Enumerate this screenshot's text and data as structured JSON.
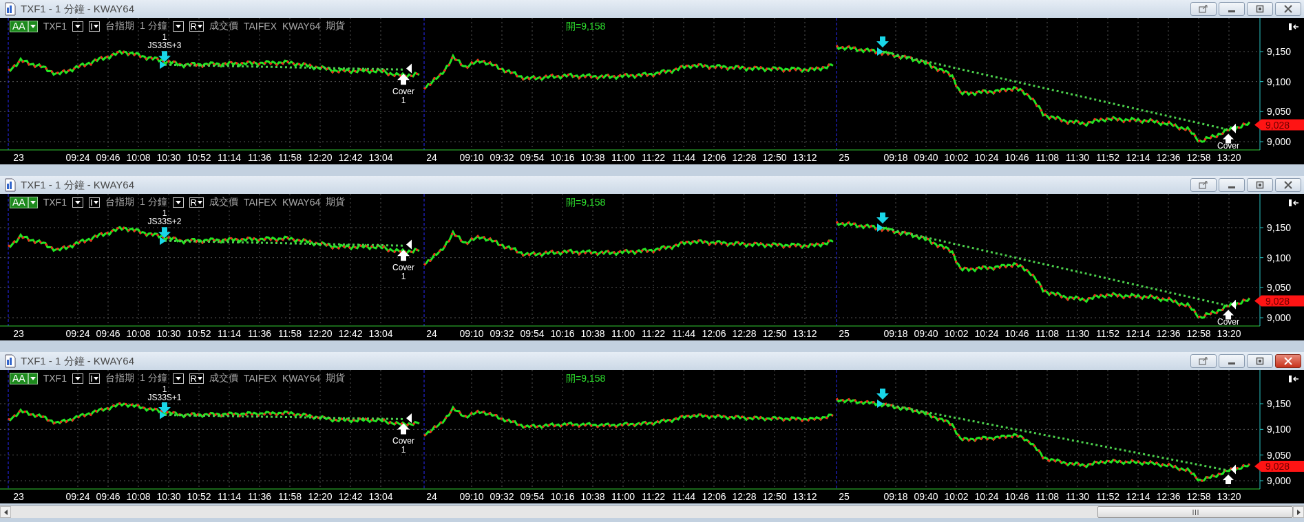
{
  "panels": [
    {
      "title": "TXF1 - 1 分鐘 - KWAY64",
      "active": false,
      "toolbar": {
        "style_button": "AA",
        "symbol": "TXF1",
        "i_button": "I",
        "market": "台指期",
        "interval": "1 分鐘",
        "r_button": "R",
        "price_type": "成交價",
        "exchange": "TAIFEX",
        "account": "KWAY64",
        "category": "期貨"
      },
      "open_label": "開=9,158",
      "entry_label": {
        "count": "1",
        "name": "JS33S+3"
      },
      "exit_label": {
        "name": "Cover",
        "count": "1"
      },
      "last_exit_label": "Cover",
      "y_ticks": [
        "9,150",
        "9,100",
        "9,050",
        "9,000"
      ],
      "last_price": "9,028",
      "sessions": [
        {
          "day": "23",
          "times": [
            "09:24",
            "09:46",
            "10:08",
            "10:30",
            "10:52",
            "11:14",
            "11:36",
            "11:58",
            "12:20",
            "12:42",
            "13:04"
          ]
        },
        {
          "day": "24",
          "times": [
            "09:10",
            "09:32",
            "09:54",
            "10:16",
            "10:38",
            "11:00",
            "11:22",
            "11:44",
            "12:06",
            "12:28",
            "12:50",
            "13:12"
          ]
        },
        {
          "day": "25",
          "times": [
            "09:18",
            "09:40",
            "10:02",
            "10:24",
            "10:46",
            "11:08",
            "11:30",
            "11:52",
            "12:14",
            "12:36",
            "12:58",
            "13:20"
          ]
        }
      ]
    },
    {
      "title": "TXF1 - 1 分鐘 - KWAY64",
      "active": false,
      "toolbar": {
        "style_button": "AA",
        "symbol": "TXF1",
        "i_button": "I",
        "market": "台指期",
        "interval": "1 分鐘",
        "r_button": "R",
        "price_type": "成交價",
        "exchange": "TAIFEX",
        "account": "KWAY64",
        "category": "期貨"
      },
      "open_label": "開=9,158",
      "entry_label": {
        "count": "1",
        "name": "JS33S+2"
      },
      "exit_label": {
        "name": "Cover",
        "count": "1"
      },
      "last_exit_label": "Cover",
      "y_ticks": [
        "9,150",
        "9,100",
        "9,050",
        "9,000"
      ],
      "last_price": "9,028",
      "sessions": [
        {
          "day": "23",
          "times": [
            "09:24",
            "09:46",
            "10:08",
            "10:30",
            "10:52",
            "11:14",
            "11:36",
            "11:58",
            "12:20",
            "12:42",
            "13:04"
          ]
        },
        {
          "day": "24",
          "times": [
            "09:10",
            "09:32",
            "09:54",
            "10:16",
            "10:38",
            "11:00",
            "11:22",
            "11:44",
            "12:06",
            "12:28",
            "12:50",
            "13:12"
          ]
        },
        {
          "day": "25",
          "times": [
            "09:18",
            "09:40",
            "10:02",
            "10:24",
            "10:46",
            "11:08",
            "11:30",
            "11:52",
            "12:14",
            "12:36",
            "12:58",
            "13:20"
          ]
        }
      ]
    },
    {
      "title": "TXF1 - 1 分鐘 - KWAY64",
      "active": true,
      "toolbar": {
        "style_button": "AA",
        "symbol": "TXF1",
        "i_button": "I",
        "market": "台指期",
        "interval": "1 分鐘",
        "r_button": "R",
        "price_type": "成交價",
        "exchange": "TAIFEX",
        "account": "KWAY64",
        "category": "期貨"
      },
      "open_label": "開=9,158",
      "entry_label": {
        "count": "1",
        "name": "JS33S+1"
      },
      "exit_label": {
        "name": "Cover",
        "count": "1"
      },
      "y_ticks": [
        "9,150",
        "9,100",
        "9,050",
        "9,000"
      ],
      "last_price": "9,028",
      "sessions": [
        {
          "day": "23",
          "times": [
            "09:24",
            "09:46",
            "10:08",
            "10:30",
            "10:52",
            "11:14",
            "11:36",
            "11:58",
            "12:20",
            "12:42",
            "13:04"
          ]
        },
        {
          "day": "24",
          "times": [
            "09:10",
            "09:32",
            "09:54",
            "10:16",
            "10:38",
            "11:00",
            "11:22",
            "11:44",
            "12:06",
            "12:28",
            "12:50",
            "13:12"
          ]
        },
        {
          "day": "25",
          "times": [
            "09:18",
            "09:40",
            "10:02",
            "10:24",
            "10:46",
            "11:08",
            "11:30",
            "11:52",
            "12:14",
            "12:36",
            "12:58",
            "13:20"
          ]
        }
      ]
    }
  ]
}
